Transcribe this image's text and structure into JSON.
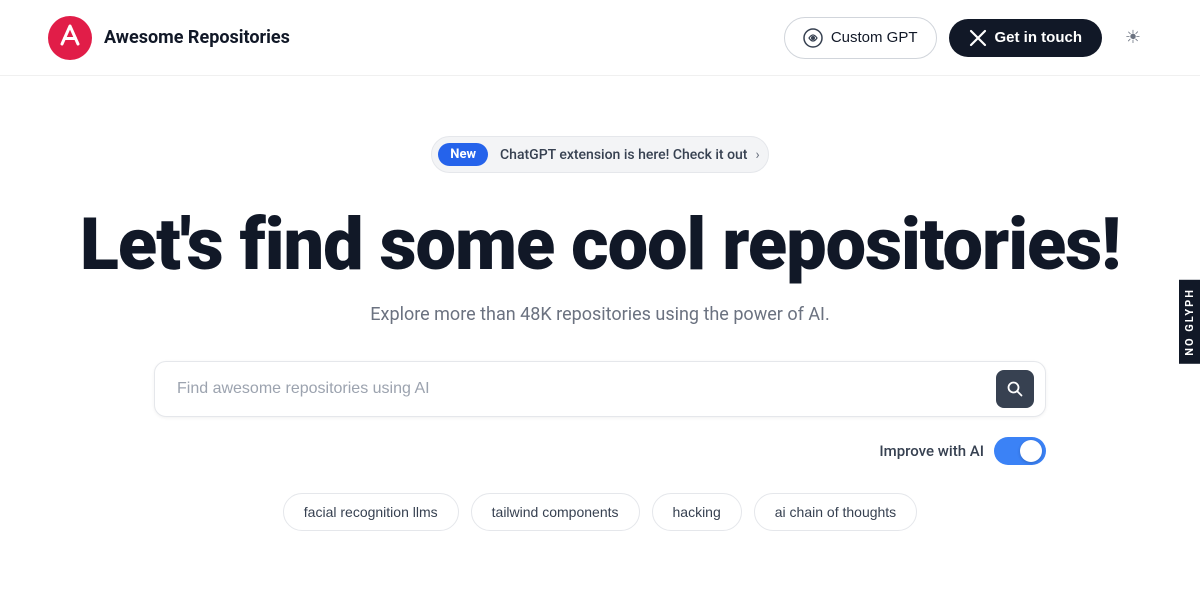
{
  "header": {
    "logo_text": "Awesome Repositories",
    "custom_gpt_label": "Custom GPT",
    "get_in_touch_label": "Get in touch",
    "theme_toggle_icon": "☀"
  },
  "announcement": {
    "badge": "New",
    "text": "ChatGPT extension is here! Check it out",
    "chevron": "›"
  },
  "hero": {
    "heading": "Let's find some cool repositories!",
    "subtext": "Explore more than 48K repositories using the power of AI."
  },
  "search": {
    "placeholder": "Find awesome repositories using AI",
    "button_icon": "🔍"
  },
  "improve_ai": {
    "label": "Improve with AI"
  },
  "tags": [
    {
      "label": "facial recognition llms"
    },
    {
      "label": "tailwind components"
    },
    {
      "label": "hacking"
    },
    {
      "label": "ai chain of thoughts"
    }
  ],
  "watermark": {
    "text": "NO GLYPH"
  }
}
